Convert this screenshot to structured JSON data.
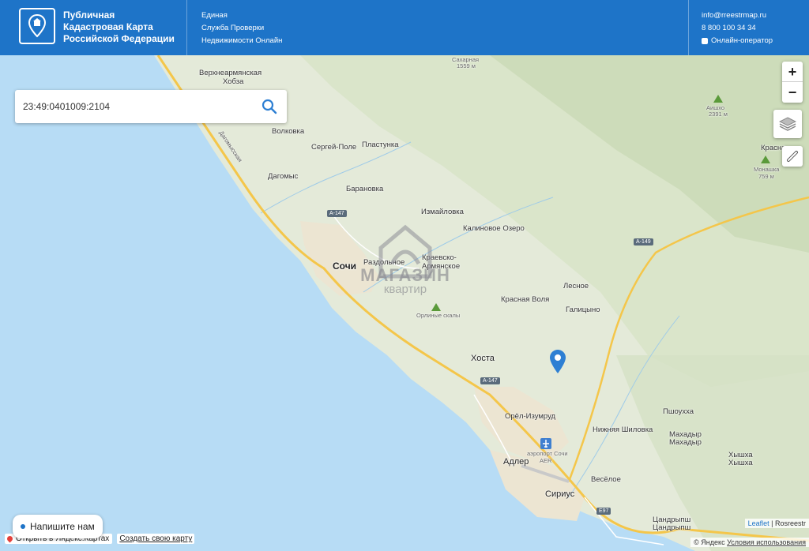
{
  "header": {
    "brand_lines": [
      "Публичная",
      "Кадастровая Карта",
      "Российской Федерации"
    ],
    "service_lines": [
      "Единая",
      "Служба Проверки",
      "Недвижимости Онлайн"
    ],
    "email": "info@rreestrmap.ru",
    "phone": "8 800 100 34 34",
    "operator": "Онлайн-оператор"
  },
  "search": {
    "value": "23:49:0401009:2104"
  },
  "zoom": {
    "in": "+",
    "out": "−"
  },
  "map": {
    "labels": {
      "verkhnearm": "Верхнеармянская",
      "khobza": "Хобза",
      "volkovka": "Волковка",
      "sergey_pole": "Сергей-Поле",
      "plastunka": "Пластунка",
      "dagomys": "Дагомыс",
      "baranovka": "Барановка",
      "izmailovka": "Измайловка",
      "kalinovoe": "Калиновое Озеро",
      "sochi": "Сочи",
      "razdolnoe": "Раздольное",
      "krasvo_arm_1": "Краевско-",
      "krasvo_arm_2": "Армянское",
      "krasnaya_volya": "Красная Воля",
      "lesnoe": "Лесное",
      "galitsyno": "Галицыно",
      "orlinye": "Орлиные скалы",
      "khosta": "Хоста",
      "orel_izumrud": "Орёл-Изумруд",
      "nizhnyaya_shilovka": "Нижняя Шиловка",
      "pshoukha": "Пшоухха",
      "makhadyr_1": "Махадыр",
      "makhadyr_2": "Махадыр",
      "khyshkha_1": "Хышха",
      "khyshkha_2": "Хышха",
      "airport_1": "аэропорт Сочи",
      "airport_2": "AER",
      "adler": "Адлер",
      "veseloe": "Весёлое",
      "sirius": "Сириус",
      "tsandrypsh_1": "Цандрыпш",
      "tsandrypsh_2": "Цандрыпш",
      "sakharnaya": "Сахарная",
      "sakharnaya_h": "1559 м",
      "aishkho": "Аишхо",
      "aishkho_h": "2391 м",
      "monashka": "Монашка",
      "monashka_h": "759 м",
      "krasnaya": "Красна",
      "dagomys_road": "Дагомысская",
      "a147_1": "А-147",
      "a147_2": "А-147",
      "a149": "А-149",
      "e97": "Е97"
    }
  },
  "watermark": {
    "line1": "МАГАЗИН",
    "line2": "квартир"
  },
  "chat": "Напишите нам",
  "yandex": {
    "open": "Открыть в Яндекс.Картах",
    "create": "Создать свою карту"
  },
  "attribution": {
    "leaflet": "Leaflet",
    "sep": " | Rosreestr",
    "yandex": "© Яндекс",
    "terms": "Условия использования"
  }
}
